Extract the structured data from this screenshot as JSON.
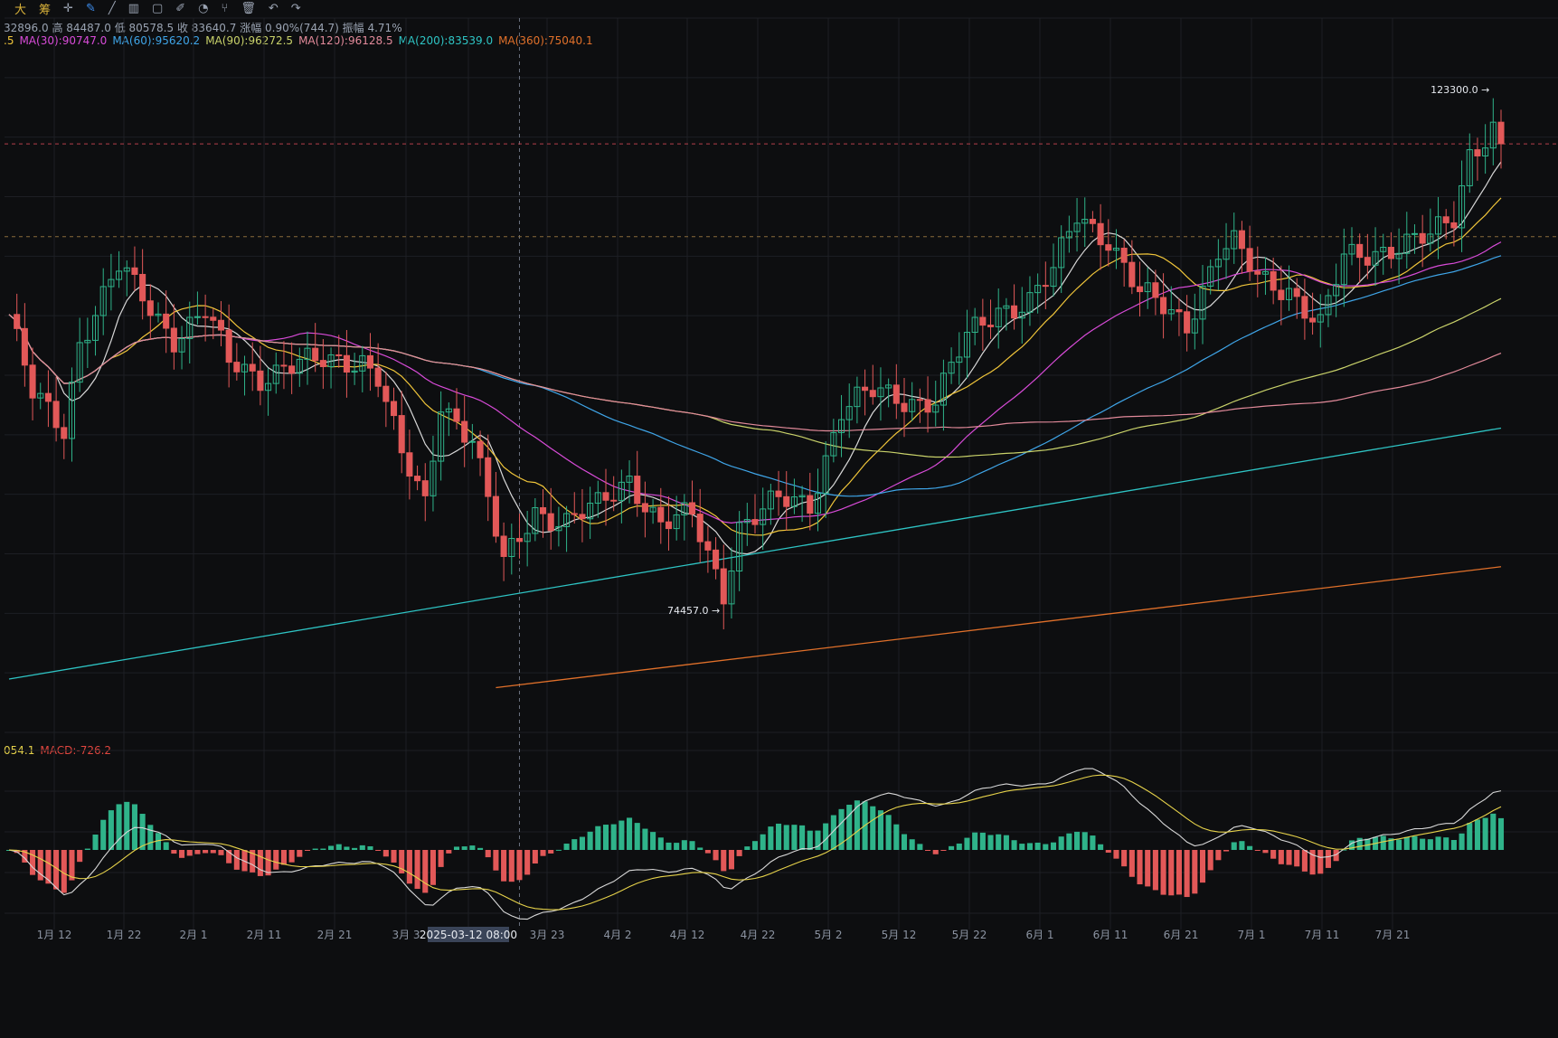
{
  "toolbar": {
    "items": [
      "大",
      "筹"
    ],
    "icons": [
      "crosshair-icon",
      "pen-icon",
      "line-icon",
      "bars-icon",
      "rect-icon",
      "edit-icon",
      "magnet-icon",
      "filter-icon",
      "trash-icon",
      "undo-icon",
      "redo-icon"
    ]
  },
  "info": {
    "ohlc_text": "32896.0 高 84487.0 低 80578.5 收 83640.7 涨幅 0.90%(744.7) 振幅 4.71%",
    "ma": [
      {
        "label": ".5",
        "color": "#f0c53a"
      },
      {
        "label": "MA(30):90747.0",
        "color": "#d84bd8"
      },
      {
        "label": "MA(60):95620.2",
        "color": "#3fa5e8"
      },
      {
        "label": "MA(90):96272.5",
        "color": "#c9d26a"
      },
      {
        "label": "MA(120):96128.5",
        "color": "#e28a9a"
      },
      {
        "label": "MA(200):83539.0",
        "color": "#2ec4c4"
      },
      {
        "label": "MA(360):75040.1",
        "color": "#e0702a"
      }
    ],
    "macd": [
      {
        "label": "054.1",
        "color": "#e6d24a"
      },
      {
        "label": "MACD:-726.2",
        "color": "#e0463f"
      }
    ]
  },
  "colors": {
    "up": "#2fb38a",
    "down": "#e25858",
    "grid": "#1d1f24",
    "bg": "#0d0e10"
  },
  "chart_data": {
    "type": "candlestick",
    "x_start": "2025-01-06",
    "x_end": "2025-07-15",
    "x_ticks": [
      "1月 12",
      "1月 22",
      "2月 1",
      "2月 11",
      "2月 21",
      "3月 3",
      "2025-03-12 08:00",
      "3月 23",
      "4月 2",
      "4月 12",
      "4月 22",
      "5月 2",
      "5月 12",
      "5月 22",
      "6月 1",
      "6月 11",
      "6月 21",
      "7月 1",
      "7月 11",
      "7月 21"
    ],
    "crosshair_label": "2025-03-12 08:00",
    "y_min_shown": 63000,
    "y_max_shown": 130000,
    "annotations": [
      {
        "text": "123300.0 →",
        "date": "2025-07-14",
        "value": 123300
      },
      {
        "text": "74457.0 →",
        "date": "2025-04-07",
        "value": 74457
      }
    ],
    "price_anchors": [
      [
        "2025-01-06",
        102200
      ],
      [
        "2025-01-09",
        94500
      ],
      [
        "2025-01-13",
        91500
      ],
      [
        "2025-01-15",
        99900
      ],
      [
        "2025-01-20",
        106500
      ],
      [
        "2025-01-22",
        104600
      ],
      [
        "2025-01-27",
        100200
      ],
      [
        "2025-01-31",
        102400
      ],
      [
        "2025-02-03",
        97600
      ],
      [
        "2025-02-07",
        96500
      ],
      [
        "2025-02-10",
        97400
      ],
      [
        "2025-02-14",
        97500
      ],
      [
        "2025-02-20",
        98200
      ],
      [
        "2025-02-22",
        96500
      ],
      [
        "2025-02-25",
        88700
      ],
      [
        "2025-02-28",
        84300
      ],
      [
        "2025-03-02",
        94200
      ],
      [
        "2025-03-06",
        90600
      ],
      [
        "2025-03-10",
        78600
      ],
      [
        "2025-03-14",
        84000
      ],
      [
        "2025-03-18",
        82700
      ],
      [
        "2025-03-22",
        84000
      ],
      [
        "2025-03-26",
        87000
      ],
      [
        "2025-03-30",
        82500
      ],
      [
        "2025-04-03",
        83100
      ],
      [
        "2025-04-07",
        76300
      ],
      [
        "2025-04-09",
        82500
      ],
      [
        "2025-04-14",
        84500
      ],
      [
        "2025-04-18",
        84500
      ],
      [
        "2025-04-22",
        93400
      ],
      [
        "2025-04-26",
        94700
      ],
      [
        "2025-04-30",
        94300
      ],
      [
        "2025-05-04",
        94300
      ],
      [
        "2025-05-08",
        99800
      ],
      [
        "2025-05-12",
        102800
      ],
      [
        "2025-05-16",
        103600
      ],
      [
        "2025-05-19",
        106000
      ],
      [
        "2025-05-22",
        111500
      ],
      [
        "2025-05-26",
        109500
      ],
      [
        "2025-05-30",
        104000
      ],
      [
        "2025-06-05",
        101500
      ],
      [
        "2025-06-09",
        108200
      ],
      [
        "2025-06-11",
        108600
      ],
      [
        "2025-06-14",
        105500
      ],
      [
        "2025-06-18",
        104800
      ],
      [
        "2025-06-22",
        101000
      ],
      [
        "2025-06-25",
        107300
      ],
      [
        "2025-06-29",
        108300
      ],
      [
        "2025-07-02",
        108800
      ],
      [
        "2025-07-06",
        109200
      ],
      [
        "2025-07-09",
        111300
      ],
      [
        "2025-07-11",
        117500
      ],
      [
        "2025-07-14",
        119800
      ],
      [
        "2025-07-15",
        117600
      ]
    ],
    "ma_final": {
      "MA(30)": 90747.0,
      "MA(60)": 95620.2,
      "MA(90)": 96272.5,
      "MA(120)": 96128.5,
      "MA(200)": 83539.0,
      "MA(360)": 75040.1
    },
    "macd_label": "MACD:-726.2",
    "dashed_levels": [
      118200,
      109500
    ]
  }
}
